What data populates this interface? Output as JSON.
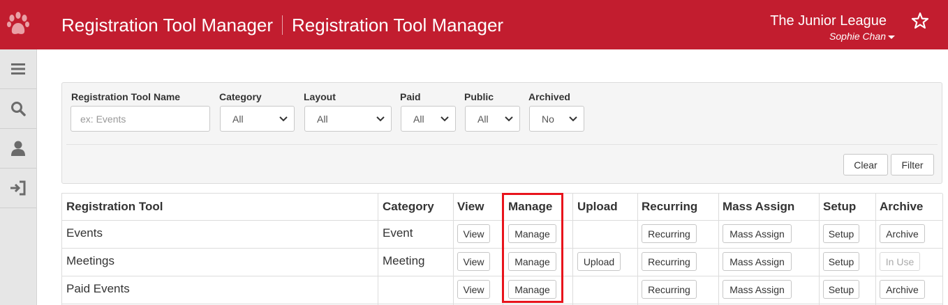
{
  "header": {
    "title_primary": "Registration Tool Manager",
    "title_secondary": "Registration Tool Manager",
    "org_name": "The Junior League",
    "user_name": "Sophie Chan",
    "bg_color": "#c21d2f"
  },
  "sidebar": {
    "items": [
      {
        "icon": "menu-icon"
      },
      {
        "icon": "search-icon"
      },
      {
        "icon": "user-icon"
      },
      {
        "icon": "sign-in-icon"
      }
    ]
  },
  "filters": {
    "name_label": "Registration Tool Name",
    "name_placeholder": "ex: Events",
    "category_label": "Category",
    "category_value": "All",
    "layout_label": "Layout",
    "layout_value": "All",
    "paid_label": "Paid",
    "paid_value": "All",
    "public_label": "Public",
    "public_value": "All",
    "archived_label": "Archived",
    "archived_value": "No",
    "clear_label": "Clear",
    "filter_label": "Filter"
  },
  "table": {
    "headers": [
      "Registration Tool",
      "Category",
      "View",
      "Manage",
      "Upload",
      "Recurring",
      "Mass Assign",
      "Setup",
      "Archive"
    ],
    "rows": [
      {
        "name": "Events",
        "category": "Event",
        "view": "View",
        "manage": "Manage",
        "upload": "",
        "recurring": "Recurring",
        "mass_assign": "Mass Assign",
        "setup": "Setup",
        "archive": "Archive"
      },
      {
        "name": "Meetings",
        "category": "Meeting",
        "view": "View",
        "manage": "Manage",
        "upload": "Upload",
        "recurring": "Recurring",
        "mass_assign": "Mass Assign",
        "setup": "Setup",
        "archive": "In Use"
      },
      {
        "name": "Paid Events",
        "category": "",
        "view": "View",
        "manage": "Manage",
        "upload": "",
        "recurring": "Recurring",
        "mass_assign": "Mass Assign",
        "setup": "Setup",
        "archive": "Archive"
      }
    ]
  },
  "highlight_color": "#e8141c"
}
